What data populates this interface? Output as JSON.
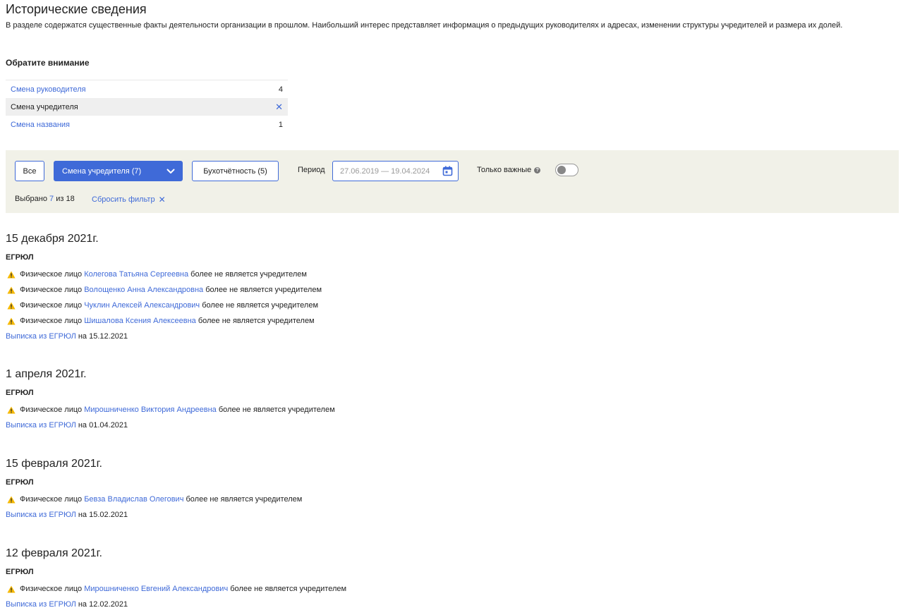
{
  "title": "Исторические сведения",
  "intro": "В разделе содержатся существенные факты деятельности организации в прошлом. Наибольший интерес представляет информация о предыдущих руководителях и адресах, изменении структуры учредителей и размера их долей.",
  "attention": {
    "title": "Обратите внимание",
    "items": [
      {
        "label": "Смена руководителя",
        "count": "4"
      },
      {
        "label": "Смена учредителя",
        "count": ""
      },
      {
        "label": "Смена названия",
        "count": "1"
      }
    ]
  },
  "filters": {
    "all_label": "Все",
    "founder_label": "Смена учредителя (7)",
    "accounting_label": "Бухотчётность (5)",
    "period_label": "Период",
    "period_value": "27.06.2019 — 19.04.2024",
    "important_label": "Только важные",
    "selected_prefix": "Выбрано",
    "selected_count": "7",
    "selected_suffix": "из 18",
    "reset_label": "Сбросить фильтр"
  },
  "events": [
    {
      "date": "15 декабря 2021г.",
      "source": "ЕГРЮЛ",
      "items": [
        {
          "prefix": "Физическое лицо",
          "name": "Колегова Татьяна Сергеевна",
          "suffix": "более не является учредителем"
        },
        {
          "prefix": "Физическое лицо",
          "name": "Волощенко Анна Александровна",
          "suffix": "более не является учредителем"
        },
        {
          "prefix": "Физическое лицо",
          "name": "Чуклин Алексей Александрович",
          "suffix": "более не является учредителем"
        },
        {
          "prefix": "Физическое лицо",
          "name": "Шишалова Ксения Алексеевна",
          "suffix": "более не является учредителем"
        }
      ],
      "extract_link": "Выписка из ЕГРЮЛ",
      "extract_date": "на 15.12.2021"
    },
    {
      "date": "1 апреля 2021г.",
      "source": "ЕГРЮЛ",
      "items": [
        {
          "prefix": "Физическое лицо",
          "name": "Мирошниченко Виктория Андреевна",
          "suffix": "более не является учредителем"
        }
      ],
      "extract_link": "Выписка из ЕГРЮЛ",
      "extract_date": "на 01.04.2021"
    },
    {
      "date": "15 февраля 2021г.",
      "source": "ЕГРЮЛ",
      "items": [
        {
          "prefix": "Физическое лицо",
          "name": "Бевза Владислав Олегович",
          "suffix": "более не является учредителем"
        }
      ],
      "extract_link": "Выписка из ЕГРЮЛ",
      "extract_date": "на 15.02.2021"
    },
    {
      "date": "12 февраля 2021г.",
      "source": "ЕГРЮЛ",
      "items": [
        {
          "prefix": "Физическое лицо",
          "name": "Мирошниченко Евгений Александрович",
          "suffix": "более не является учредителем"
        }
      ],
      "extract_link": "Выписка из ЕГРЮЛ",
      "extract_date": "на 12.02.2021"
    }
  ],
  "colors": {
    "accent": "#3f6ad8",
    "warning": "#f5b800",
    "panel": "#f1f1e8"
  }
}
